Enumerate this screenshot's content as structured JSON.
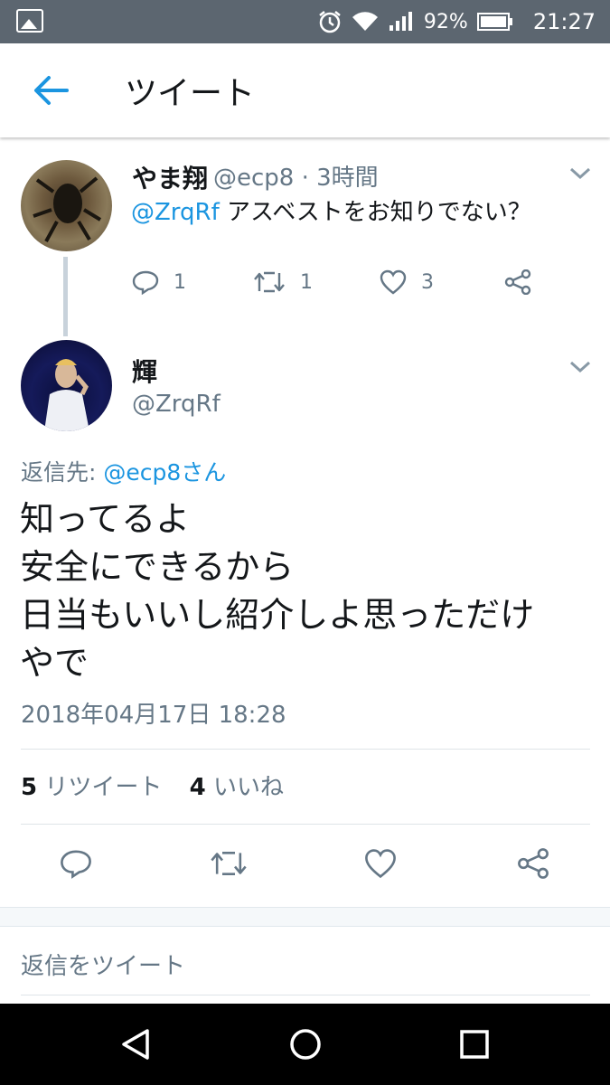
{
  "status_bar": {
    "battery": "92%",
    "time": "21:27"
  },
  "header": {
    "title": "ツイート"
  },
  "parent_tweet": {
    "display_name": "やま翔",
    "handle_time": "@ecp8 · 3時間",
    "mention": "@ZrqRf",
    "text": " アスベストをお知りでない？",
    "reply_count": "1",
    "retweet_count": "1",
    "like_count": "3"
  },
  "main_tweet": {
    "display_name": "輝",
    "handle": "@ZrqRf",
    "reply_to_label": "返信先: ",
    "reply_to_target": "@ecp8さん",
    "lines": [
      "知ってるよ",
      "安全にできるから",
      "日当もいいし紹介しよ思っただけ",
      "やで"
    ],
    "timestamp": "2018年04月17日 18:28",
    "retweets_count": "5",
    "retweets_label": " リツイート",
    "likes_count": "4",
    "likes_label": " いいね"
  },
  "reply_box": {
    "placeholder": "返信をツイート"
  },
  "colors": {
    "accent": "#1b95e0",
    "status_bar": "#5c6670",
    "secondary_text": "#657786"
  }
}
